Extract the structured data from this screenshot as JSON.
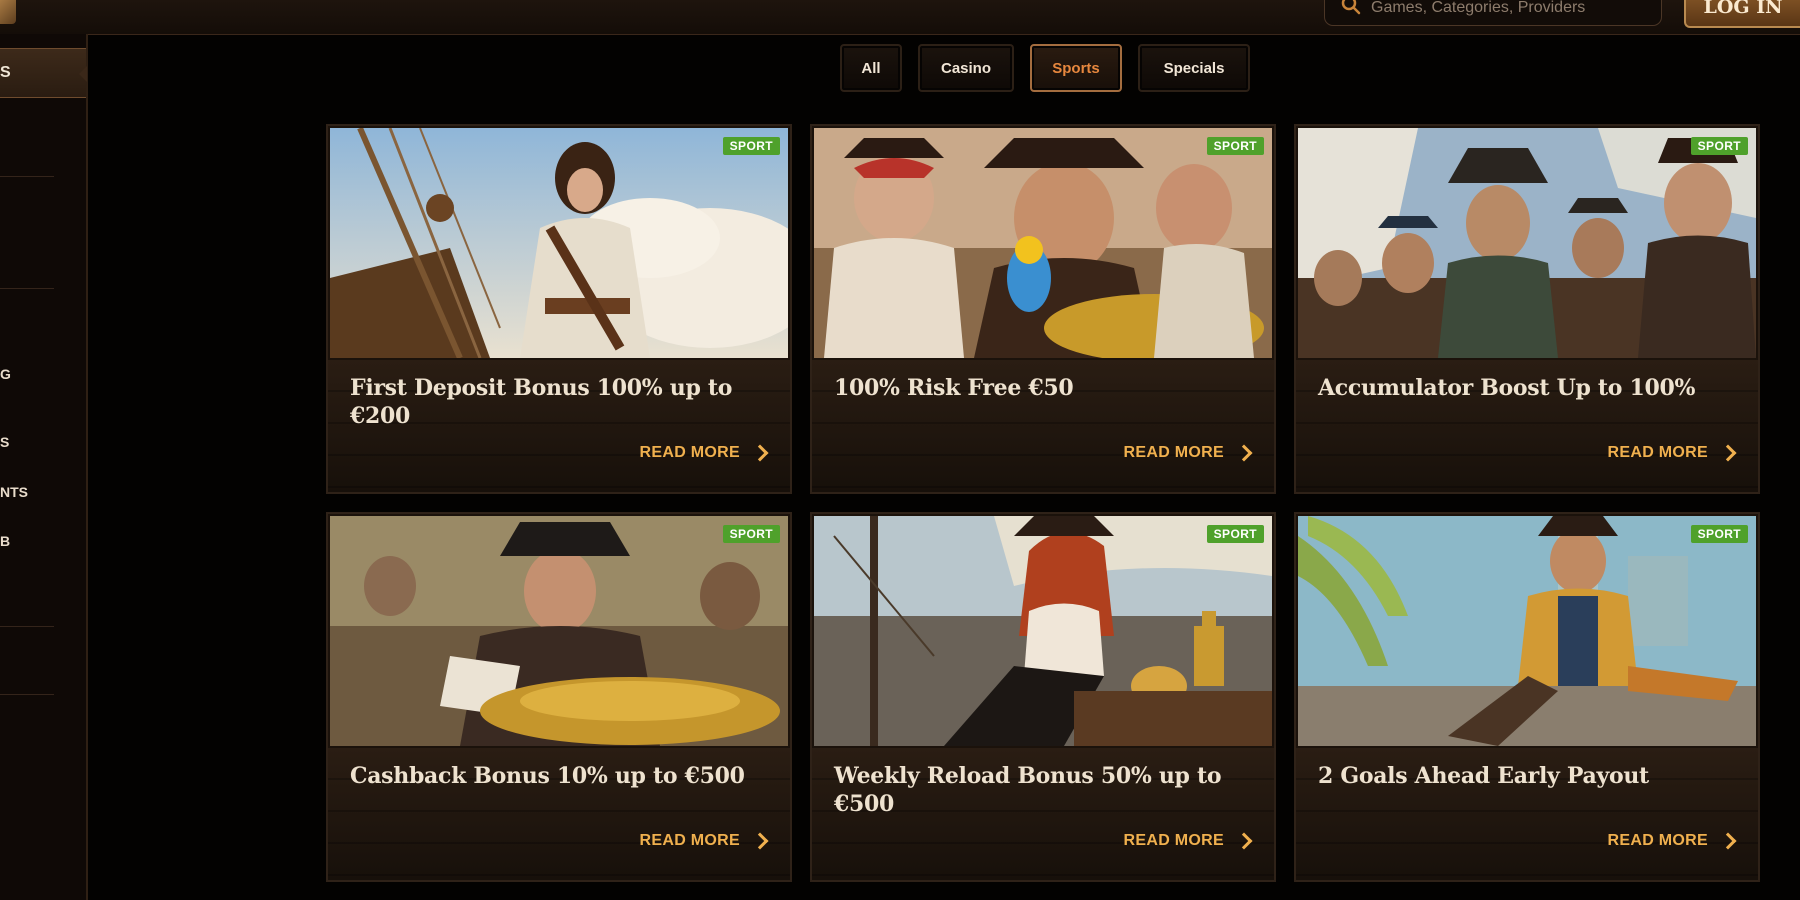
{
  "header": {
    "search": {
      "placeholder": "Games, Categories, Providers"
    },
    "login_label": "LOG IN"
  },
  "sidebar": {
    "active_item": "S",
    "items": [
      {
        "label": "G"
      },
      {
        "label": "S"
      },
      {
        "label": "NTS"
      },
      {
        "label": "B"
      }
    ]
  },
  "tabs": [
    {
      "label": "All"
    },
    {
      "label": "Casino"
    },
    {
      "label": "Sports",
      "active": true
    },
    {
      "label": "Specials"
    }
  ],
  "promos": [
    {
      "title": "First Deposit Bonus 100% up to €200",
      "badge": "SPORT",
      "cta": "READ MORE",
      "image": "pirate-woman-on-ship-deck"
    },
    {
      "title": "100% Risk Free €50",
      "badge": "SPORT",
      "cta": "READ MORE",
      "image": "pirates-with-parrot-and-gold"
    },
    {
      "title": "Accumulator Boost Up to 100%",
      "badge": "SPORT",
      "cta": "READ MORE",
      "image": "pirate-crew-group"
    },
    {
      "title": "Cashback Bonus 10% up to €500",
      "badge": "SPORT",
      "cta": "READ MORE",
      "image": "pirate-with-coin-pile"
    },
    {
      "title": "Weekly Reload Bonus 50% up to €500",
      "badge": "SPORT",
      "cta": "READ MORE",
      "image": "red-haired-pirate-woman-with-rum"
    },
    {
      "title": "2 Goals Ahead Early Payout",
      "badge": "SPORT",
      "cta": "READ MORE",
      "image": "pirate-reclining-tropical-port"
    }
  ],
  "colors": {
    "accent": "#e7873e",
    "cta": "#f0b04e",
    "badge": "#4fa12b",
    "background": "#030201"
  }
}
